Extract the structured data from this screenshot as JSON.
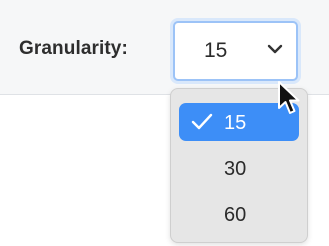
{
  "granularity": {
    "label": "Granularity:",
    "selected_value": "15",
    "options": [
      {
        "label": "15",
        "selected": true
      },
      {
        "label": "30",
        "selected": false
      },
      {
        "label": "60",
        "selected": false
      }
    ]
  },
  "colors": {
    "accent": "#3d8ef7",
    "focus_ring": "#9cc3f7",
    "toolbar_bg": "#f6f7f8",
    "menu_bg": "#e6e6e6"
  },
  "icons": {
    "select_chevron": "chevron-down-icon",
    "selected_mark": "checkmark-icon",
    "pointer": "mouse-cursor-icon"
  }
}
